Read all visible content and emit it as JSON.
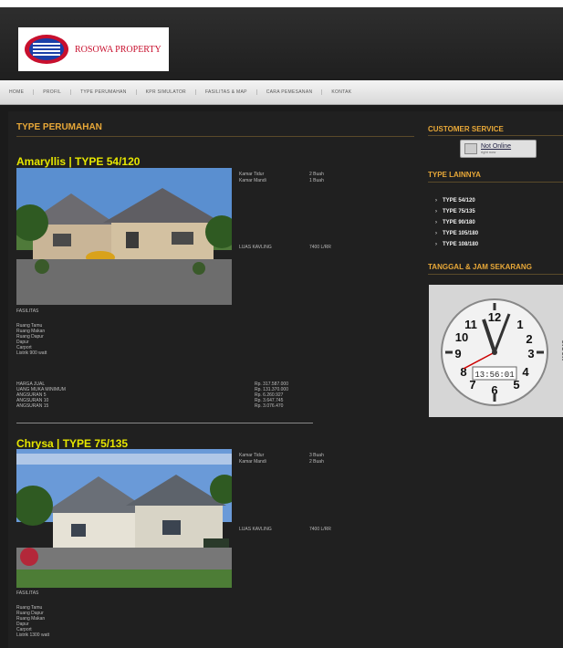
{
  "header": {
    "logo_text": "ROSOWA PROPERTY"
  },
  "nav": {
    "items": [
      "HOME",
      "PROFIL",
      "TYPE PERUMAHAN",
      "KPR SIMULATOR",
      "FASILITAS & MAP",
      "CARA PEMESANAN",
      "KONTAK"
    ]
  },
  "main": {
    "heading": "TYPE PERUMAHAN",
    "houses": [
      {
        "title": "Amaryllis | TYPE 54/120",
        "specs": [
          {
            "label": "Kamar Tidur",
            "value": "2 Buah"
          },
          {
            "label": "Kamar Mandi",
            "value": "1 Buah"
          }
        ],
        "area_label": "LUAS KAVLING",
        "area_value": "7400 L/RR",
        "fasilitas_label": "FASILITAS",
        "facilities": [
          "Ruang Tamu",
          "Ruang Makan",
          "Ruang Dapur",
          "Dapur",
          "Carport",
          "Listrik 900 watt"
        ],
        "prices": [
          {
            "label": "HARGA JUAL",
            "value": "Rp. 317.587.000"
          },
          {
            "label": "UANG MUKA MINIMUM",
            "value": "Rp. 131.370.000"
          },
          {
            "label": "ANGSURAN 5",
            "value": "Rp. 6.260.927"
          },
          {
            "label": "ANGSURAN 10",
            "value": "Rp. 3.647.745"
          },
          {
            "label": "ANGSURAN 15",
            "value": "Rp. 3.076.470"
          }
        ]
      },
      {
        "title": "Chrysa | TYPE 75/135",
        "specs": [
          {
            "label": "Kamar Tidur",
            "value": "3 Buah"
          },
          {
            "label": "Kamar Mandi",
            "value": "2 Buah"
          }
        ],
        "area_label": "LUAS KAVLING",
        "area_value": "7400 L/RR",
        "fasilitas_label": "FASILITAS",
        "facilities": [
          "Ruang Tamu",
          "Ruang Dapur",
          "Ruang Makan",
          "Dapur",
          "Carport",
          "Listrik 1300 watt"
        ]
      }
    ]
  },
  "sidebar": {
    "cs_heading": "CUSTOMER SERVICE",
    "online_label": "Not Online",
    "online_sub": "right now",
    "types_heading": "TYPE LAINNYA",
    "types": [
      "TYPE 54/120",
      "TYPE 75/135",
      "TYPE 90/180",
      "TYPE 105/180",
      "TYPE 108/180"
    ],
    "clock_heading": "TANGGAL & JAM SEKARANG",
    "clock": {
      "time": "13:56:01",
      "brand": "clock"
    }
  },
  "colors": {
    "accent": "#e8a838",
    "title": "#e6e600",
    "background": "#1b1b1b"
  }
}
